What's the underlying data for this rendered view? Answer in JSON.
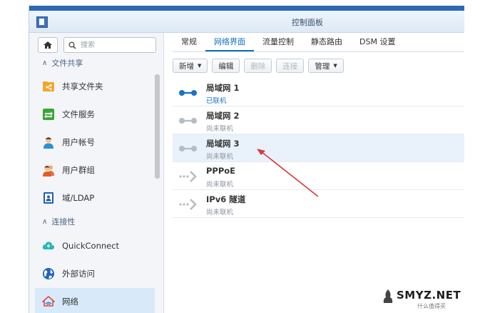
{
  "window": {
    "title": "控制面板"
  },
  "sidebar": {
    "search_placeholder": "搜索",
    "sections": [
      {
        "label": "文件共享",
        "expanded": true
      },
      {
        "label": "连接性",
        "expanded": true
      }
    ],
    "items": [
      {
        "label": "共享文件夹",
        "icon": "shared-folder-icon",
        "active": false
      },
      {
        "label": "文件服务",
        "icon": "file-services-icon",
        "active": false
      },
      {
        "label": "用户帐号",
        "icon": "user-icon",
        "active": false
      },
      {
        "label": "用户群组",
        "icon": "user-group-icon",
        "active": false
      },
      {
        "label": "域/LDAP",
        "icon": "domain-ldap-icon",
        "active": false
      },
      {
        "label": "QuickConnect",
        "icon": "quickconnect-icon",
        "active": false
      },
      {
        "label": "外部访问",
        "icon": "external-access-icon",
        "active": false
      },
      {
        "label": "网络",
        "icon": "network-house-icon",
        "active": true
      }
    ]
  },
  "tabs": [
    {
      "label": "常规",
      "active": false
    },
    {
      "label": "网络界面",
      "active": true
    },
    {
      "label": "流量控制",
      "active": false
    },
    {
      "label": "静态路由",
      "active": false
    },
    {
      "label": "DSM 设置",
      "active": false
    }
  ],
  "toolbar": {
    "create": "新增",
    "edit": "编辑",
    "delete": "删除",
    "connect": "连接",
    "manage": "管理"
  },
  "interfaces": [
    {
      "name": "局域网 1",
      "status": "已联机",
      "connected": true
    },
    {
      "name": "局域网 2",
      "status": "尚未联机",
      "connected": false
    },
    {
      "name": "局域网 3",
      "status": "尚未联机",
      "connected": false
    },
    {
      "name": "PPPoE",
      "status": "尚未联机",
      "connected": false
    },
    {
      "name": "IPv6 隧道",
      "status": "尚未联机",
      "connected": false
    }
  ],
  "colors": {
    "accent": "#0f6fc6",
    "connected": "#1a73c8",
    "disconnected": "#b5bcc4",
    "annotation_arrow": "#d9373a"
  },
  "watermark": {
    "text": "SMYZ.NET",
    "sub": "什么值得买"
  }
}
